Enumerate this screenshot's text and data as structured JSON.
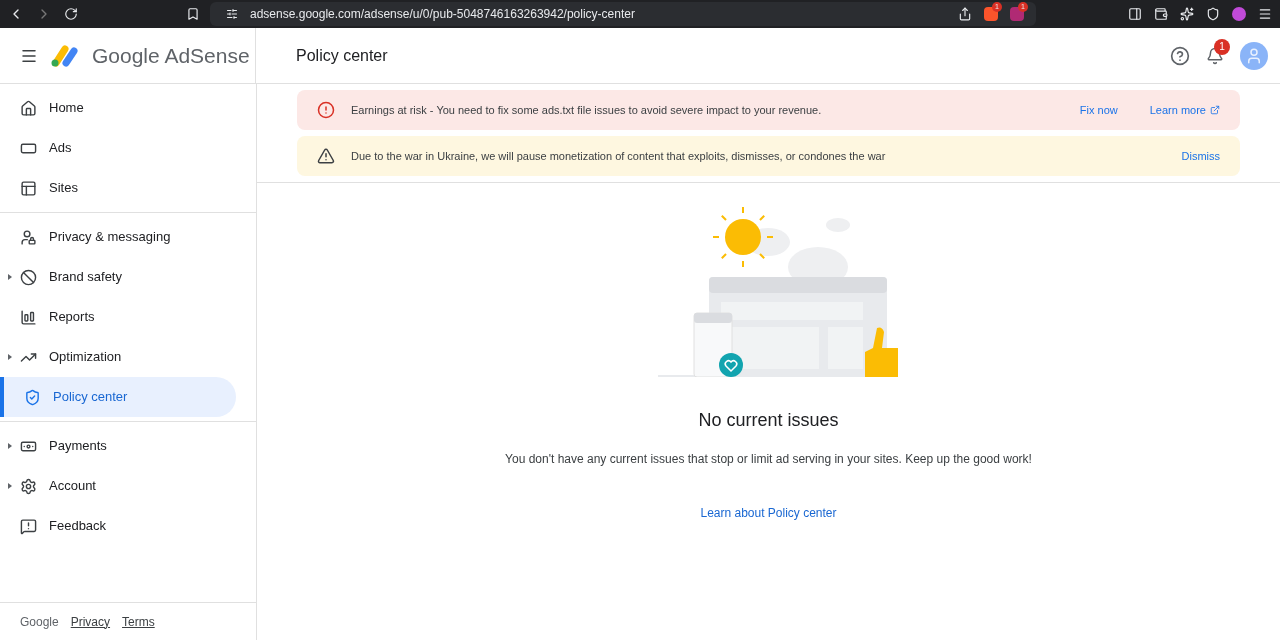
{
  "browser": {
    "url": "adsense.google.com/adsense/u/0/pub-5048746163263942/policy-center",
    "extension_badges": [
      "1",
      "1"
    ]
  },
  "header": {
    "brand": "Google AdSense",
    "page_title": "Policy center",
    "notification_count": "1"
  },
  "sidebar": {
    "groups": [
      [
        {
          "label": "Home",
          "expandable": false,
          "selected": false
        },
        {
          "label": "Ads",
          "expandable": false,
          "selected": false
        },
        {
          "label": "Sites",
          "expandable": false,
          "selected": false
        }
      ],
      [
        {
          "label": "Privacy & messaging",
          "expandable": false,
          "selected": false
        },
        {
          "label": "Brand safety",
          "expandable": true,
          "selected": false
        },
        {
          "label": "Reports",
          "expandable": false,
          "selected": false
        },
        {
          "label": "Optimization",
          "expandable": true,
          "selected": false
        },
        {
          "label": "Policy center",
          "expandable": false,
          "selected": true
        }
      ],
      [
        {
          "label": "Payments",
          "expandable": true,
          "selected": false
        },
        {
          "label": "Account",
          "expandable": true,
          "selected": false
        },
        {
          "label": "Feedback",
          "expandable": false,
          "selected": false
        }
      ]
    ],
    "footer": {
      "brand": "Google",
      "links": [
        "Privacy",
        "Terms"
      ]
    }
  },
  "alerts": [
    {
      "kind": "error",
      "message": "Earnings at risk - You need to fix some ads.txt file issues to avoid severe impact to your revenue.",
      "actions": [
        {
          "label": "Fix now",
          "external": false
        },
        {
          "label": "Learn more",
          "external": true
        }
      ]
    },
    {
      "kind": "warning",
      "message": "Due to the war in Ukraine, we will pause monetization of content that exploits, dismisses, or condones the war",
      "actions": [
        {
          "label": "Dismiss",
          "external": false
        }
      ]
    }
  ],
  "empty_state": {
    "title": "No current issues",
    "message": "You don't have any current issues that stop or limit ad serving in your sites. Keep up the good work!",
    "link": "Learn about Policy center"
  }
}
